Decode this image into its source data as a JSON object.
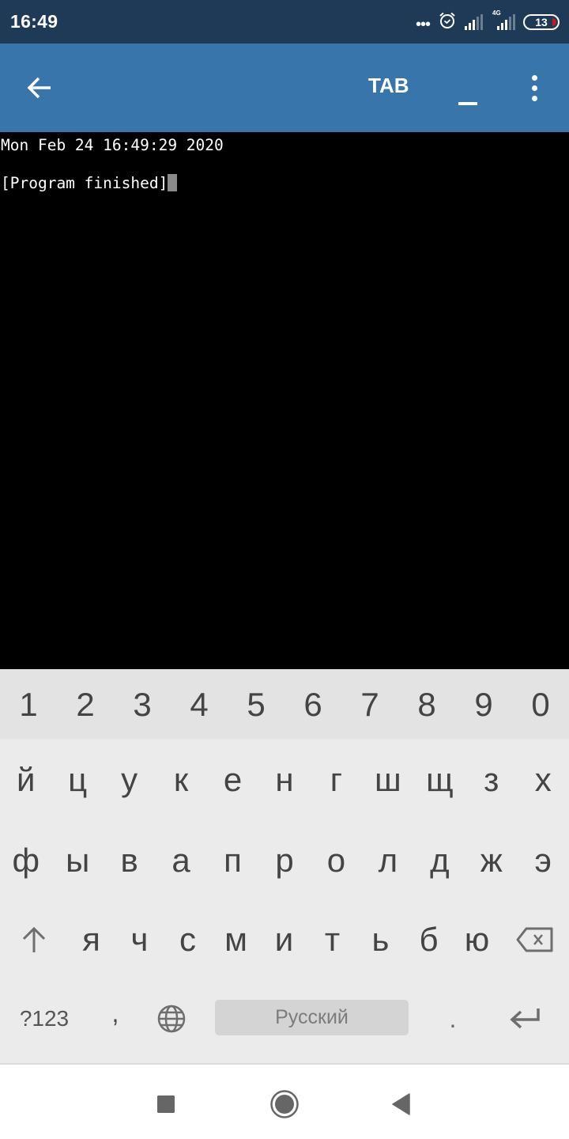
{
  "status_bar": {
    "time": "16:49",
    "notification_dots": "•••",
    "alarm_icon": "alarm-clock-icon",
    "signal1_icon": "cell-signal-icon",
    "network_type": "4G",
    "signal2_icon": "cell-signal-4g-icon",
    "battery_level": "13",
    "battery_color": "#d01818"
  },
  "app_bar": {
    "back_icon": "arrow-left-icon",
    "tab_label": "TAB",
    "minus_label": "_",
    "menu_icon": "more-vertical-icon",
    "background": "#3875ab"
  },
  "terminal": {
    "lines": [
      "Mon Feb 24 16:49:29 2020",
      "",
      "[Program finished]"
    ]
  },
  "keyboard": {
    "number_row": [
      "1",
      "2",
      "3",
      "4",
      "5",
      "6",
      "7",
      "8",
      "9",
      "0"
    ],
    "row1": [
      "й",
      "ц",
      "у",
      "к",
      "е",
      "н",
      "г",
      "ш",
      "щ",
      "з",
      "х"
    ],
    "row2": [
      "ф",
      "ы",
      "в",
      "а",
      "п",
      "р",
      "о",
      "л",
      "д",
      "ж",
      "э"
    ],
    "row3": [
      "я",
      "ч",
      "с",
      "м",
      "и",
      "т",
      "ь",
      "б",
      "ю"
    ],
    "shift_icon": "shift-arrow-up-icon",
    "backspace_icon": "backspace-icon",
    "symbols_label": "?123",
    "comma_label": ",",
    "globe_icon": "globe-icon",
    "space_label": "Русский",
    "period_label": ".",
    "enter_icon": "enter-return-icon"
  },
  "nav_bar": {
    "recents_icon": "recents-square-icon",
    "home_icon": "home-circle-icon",
    "back_icon": "back-triangle-icon"
  }
}
